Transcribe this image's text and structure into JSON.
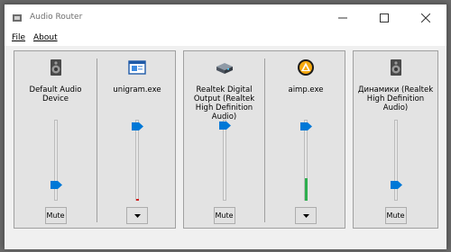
{
  "window": {
    "title": "Audio Router"
  },
  "menu": [
    {
      "label": "File"
    },
    {
      "label": "About"
    }
  ],
  "devices": [
    {
      "channels": [
        {
          "label": "Default Audio Device",
          "icon": "speaker-icon",
          "volume": 0.2,
          "meter": 0.0,
          "button": "Mute"
        },
        {
          "label": "unigram.exe",
          "icon": "app-window-icon",
          "volume": 0.92,
          "meter": 0.02,
          "button": "dropdown"
        }
      ]
    },
    {
      "channels": [
        {
          "label": "Realtek Digital Output (Realtek High Definition Audio)",
          "icon": "digital-output-icon",
          "volume": 0.93,
          "meter": 0.0,
          "button": "Mute"
        },
        {
          "label": "aimp.exe",
          "icon": "aimp-icon",
          "volume": 0.92,
          "meter": 0.28,
          "button": "dropdown"
        }
      ]
    },
    {
      "channels": [
        {
          "label": "Динамики (Realtek High Definition Audio)",
          "icon": "speaker-icon",
          "volume": 0.2,
          "meter": 0.0,
          "button": "Mute"
        }
      ]
    }
  ],
  "colors": {
    "accent": "#0078d7",
    "meter": "#2eae4e",
    "meter_peak": "#d32020"
  }
}
